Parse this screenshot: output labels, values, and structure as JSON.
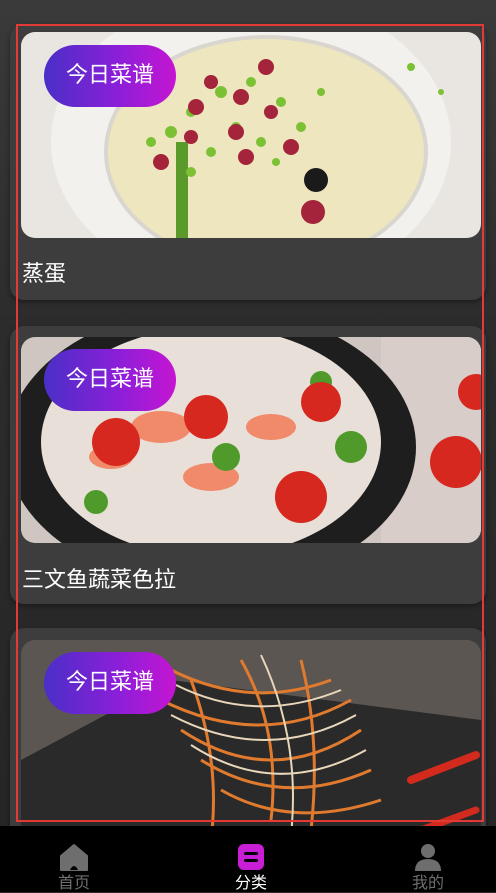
{
  "badge_label": "今日菜谱",
  "recipes": [
    {
      "title": "蒸蛋"
    },
    {
      "title": "三文鱼蔬菜色拉"
    },
    {
      "title": ""
    }
  ],
  "tabs": [
    {
      "label": "首页",
      "icon": "home-icon",
      "active": false
    },
    {
      "label": "分类",
      "icon": "category-icon",
      "active": true
    },
    {
      "label": "我的",
      "icon": "user-icon",
      "active": false
    }
  ],
  "colors": {
    "active_tab": "#c81fd6",
    "inactive_tab": "#6e6e6e",
    "badge_start": "#4a2fc7",
    "badge_end": "#c515d2"
  }
}
